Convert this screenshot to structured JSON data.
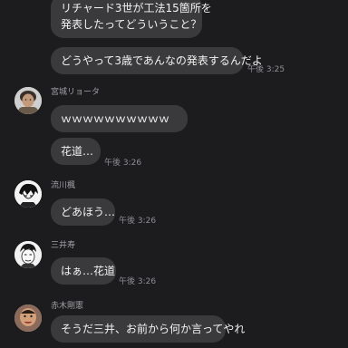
{
  "messages": [
    {
      "id": "m1",
      "lines": [
        "リチャード3世が工法15箇所を",
        "発表したってどういうこと？"
      ]
    },
    {
      "id": "m2",
      "text": "どうやって3歳であんなの発表するんだよ",
      "time": "午後 3:25"
    },
    {
      "id": "m3",
      "sender": "宮城リョータ",
      "text": "ｗｗｗｗｗｗｗｗｗｗ"
    },
    {
      "id": "m4",
      "text": "花道…",
      "time": "午後 3:26"
    },
    {
      "id": "m5",
      "sender": "流川楓",
      "text": "どあほう…",
      "time": "午後 3:26"
    },
    {
      "id": "m6",
      "sender": "三井寿",
      "text": "はぁ…花道",
      "time": "午後 3:26"
    },
    {
      "id": "m7",
      "sender": "赤木剛憲",
      "text": "そうだ三井、お前から何か言ってやれ"
    }
  ],
  "avatars": {
    "miyagi": "avatar-photo",
    "rukawa": "manga-avatar",
    "mitsui": "manga-avatar",
    "akagi": "avatar-photo"
  }
}
